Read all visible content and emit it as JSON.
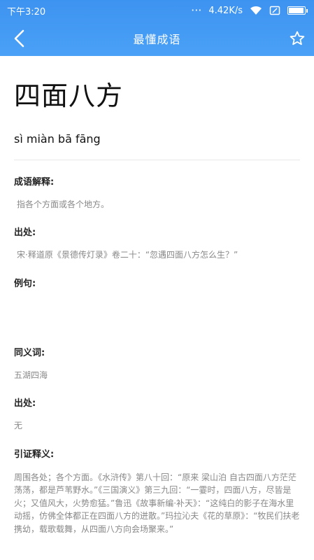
{
  "status": {
    "time": "下午3:20",
    "speed": "4.42K/s"
  },
  "nav": {
    "title": "最懂成语"
  },
  "idiom": {
    "word": "四面八方",
    "pinyin": "sì miàn bā fāng"
  },
  "sections": {
    "meaning_label": "成语解释:",
    "meaning": "指各个方面或各个地方。",
    "source_label": "出处:",
    "source": "宋·释道原《景德传灯录》卷二十：“忽遇四面八方怎么生？”",
    "example_label": "例句:",
    "example": "",
    "synonym_label": "同义词:",
    "synonym": "五湖四海",
    "origin_label": "出处:",
    "origin": "无",
    "cited_label": "引证释义:",
    "cited": "周围各处；各个方面。《水浒传》第八十回：“原来 梁山泊 自古四面八方茫茫荡荡，都是芦苇野水。”《三国演义》第三九回：“一霎时，四面八方，尽皆是火；又值风大，火势愈猛。”鲁迅《故事新编·补天》：“这纯白的影子在海水里动摇，仿佛全体都正在四面八方的迸散。”玛拉沁夫《花的草原》：“牧民们扶老携幼，载歌载舞，从四面八方向会场聚来。”"
  }
}
